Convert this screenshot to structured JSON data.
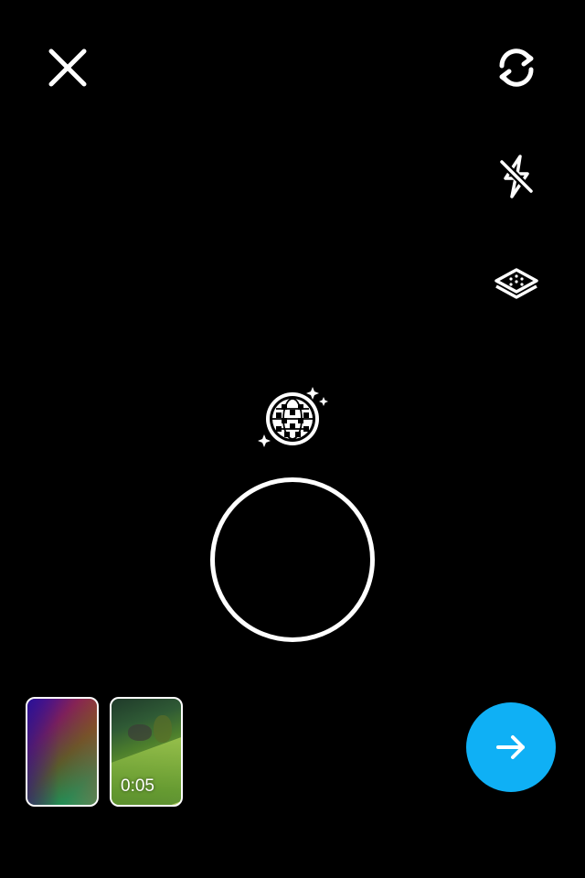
{
  "camera": {
    "top_left": {
      "icon": "close-icon"
    },
    "right_controls": [
      {
        "id": "flip",
        "icon": "flip-camera-icon"
      },
      {
        "id": "flash",
        "icon": "flash-off-icon"
      },
      {
        "id": "layers",
        "icon": "layers-icon"
      }
    ],
    "effects": {
      "icon": "disco-ball-icon"
    },
    "shutter": {
      "icon": "shutter-ring"
    },
    "gallery": [
      {
        "id": "thumb-1",
        "duration": ""
      },
      {
        "id": "thumb-2",
        "duration": "0:05"
      }
    ],
    "next": {
      "icon": "arrow-right-icon"
    }
  },
  "colors": {
    "background": "#000000",
    "foreground": "#ffffff",
    "next_button": "#0fb0f5"
  }
}
